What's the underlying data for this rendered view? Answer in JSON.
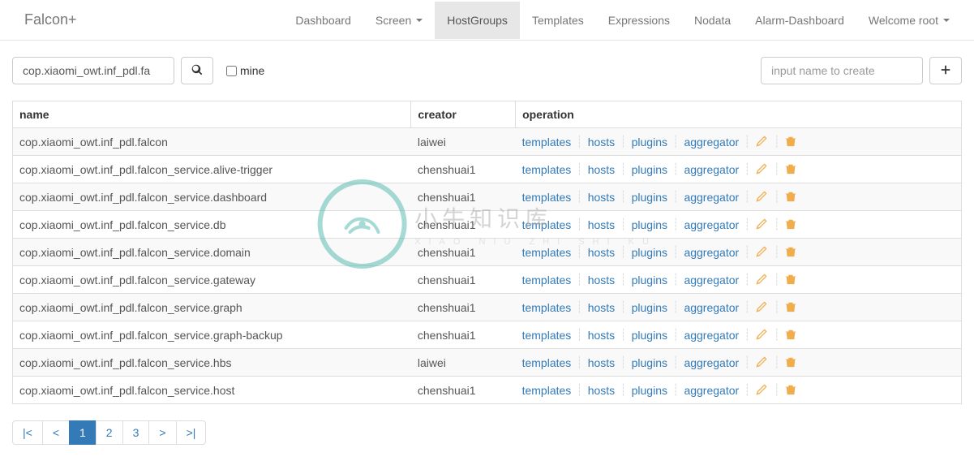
{
  "brand": "Falcon+",
  "nav": [
    {
      "label": "Dashboard",
      "active": false,
      "dropdown": false
    },
    {
      "label": "Screen",
      "active": false,
      "dropdown": true
    },
    {
      "label": "HostGroups",
      "active": true,
      "dropdown": false
    },
    {
      "label": "Templates",
      "active": false,
      "dropdown": false
    },
    {
      "label": "Expressions",
      "active": false,
      "dropdown": false
    },
    {
      "label": "Nodata",
      "active": false,
      "dropdown": false
    },
    {
      "label": "Alarm-Dashboard",
      "active": false,
      "dropdown": false
    },
    {
      "label": "Welcome root",
      "active": false,
      "dropdown": true
    }
  ],
  "search": {
    "value": "cop.xiaomi_owt.inf_pdl.fa"
  },
  "mine_checkbox": {
    "label": "mine",
    "checked": false
  },
  "create": {
    "placeholder": "input name to create"
  },
  "table": {
    "headers": {
      "name": "name",
      "creator": "creator",
      "operation": "operation"
    },
    "op_labels": {
      "templates": "templates",
      "hosts": "hosts",
      "plugins": "plugins",
      "aggregator": "aggregator"
    },
    "rows": [
      {
        "name": "cop.xiaomi_owt.inf_pdl.falcon",
        "creator": "laiwei"
      },
      {
        "name": "cop.xiaomi_owt.inf_pdl.falcon_service.alive-trigger",
        "creator": "chenshuai1"
      },
      {
        "name": "cop.xiaomi_owt.inf_pdl.falcon_service.dashboard",
        "creator": "chenshuai1"
      },
      {
        "name": "cop.xiaomi_owt.inf_pdl.falcon_service.db",
        "creator": "chenshuai1"
      },
      {
        "name": "cop.xiaomi_owt.inf_pdl.falcon_service.domain",
        "creator": "chenshuai1"
      },
      {
        "name": "cop.xiaomi_owt.inf_pdl.falcon_service.gateway",
        "creator": "chenshuai1"
      },
      {
        "name": "cop.xiaomi_owt.inf_pdl.falcon_service.graph",
        "creator": "chenshuai1"
      },
      {
        "name": "cop.xiaomi_owt.inf_pdl.falcon_service.graph-backup",
        "creator": "chenshuai1"
      },
      {
        "name": "cop.xiaomi_owt.inf_pdl.falcon_service.hbs",
        "creator": "laiwei"
      },
      {
        "name": "cop.xiaomi_owt.inf_pdl.falcon_service.host",
        "creator": "chenshuai1"
      }
    ]
  },
  "pagination": {
    "first": "|<",
    "prev": "<",
    "pages": [
      "1",
      "2",
      "3"
    ],
    "active": "1",
    "next": ">",
    "last": ">|"
  },
  "watermark": {
    "main": "小牛知识库",
    "sub": "XIAO NIU ZHI SHI KU"
  }
}
